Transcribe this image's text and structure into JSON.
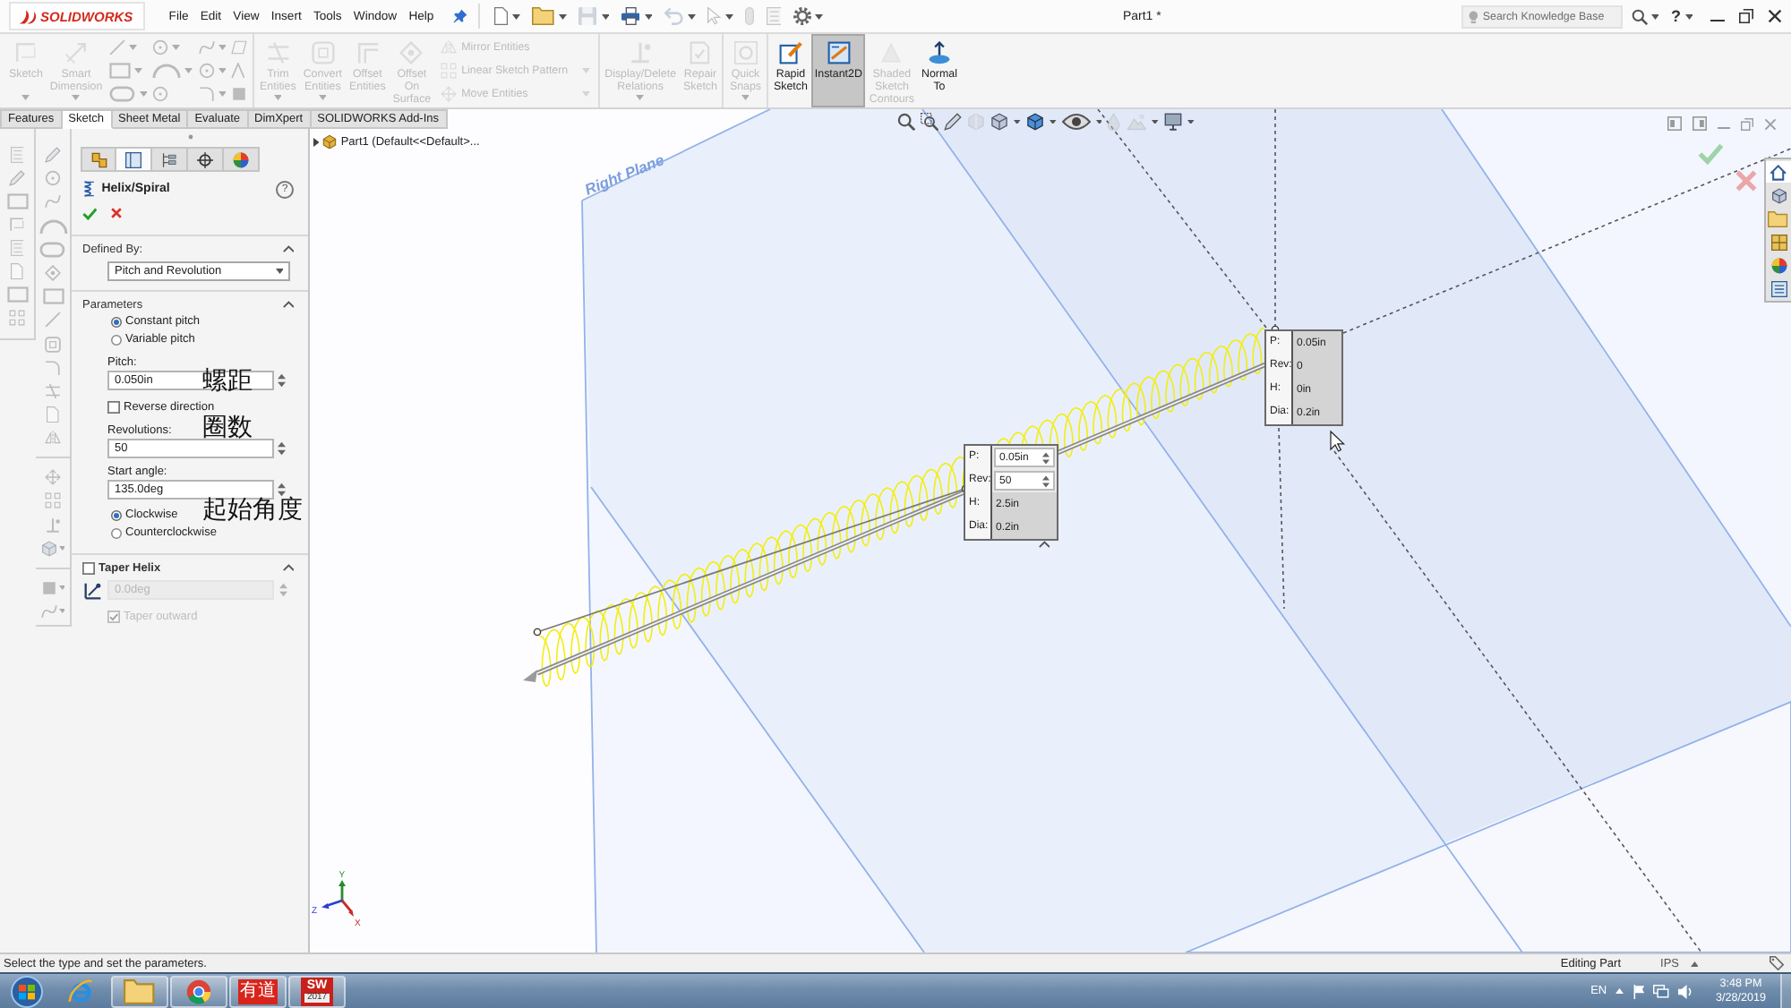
{
  "title_bar": {
    "logo": "SOLIDWORKS",
    "menu": [
      "File",
      "Edit",
      "View",
      "Insert",
      "Tools",
      "Window",
      "Help"
    ],
    "title": "Part1 *",
    "search": {
      "placeholder": "Search Knowledge Base"
    },
    "help": "?"
  },
  "quick_access": [
    {
      "disabled": false,
      "dropdown": true
    },
    {
      "disabled": false,
      "dropdown": true
    },
    {
      "disabled": true,
      "dropdown": true
    },
    {
      "disabled": false,
      "dropdown": true
    },
    {
      "disabled": true,
      "dropdown": true
    },
    {
      "disabled": true,
      "dropdown": true
    },
    {
      "disabled": true,
      "dropdown": false
    },
    {
      "disabled": true,
      "dropdown": false
    },
    {
      "disabled": false,
      "dropdown": true
    }
  ],
  "ribbon": {
    "groups": [
      [
        {
          "kind": "large",
          "label": "Sketch",
          "disabled": true,
          "on": false,
          "dropdown": true
        },
        {
          "kind": "large",
          "label": "Smart Dimension",
          "disabled": true,
          "on": false,
          "dropdown": true
        },
        {
          "kind": "entities",
          "disabled": true
        }
      ],
      [
        {
          "kind": "large",
          "label": "Trim Entities",
          "disabled": true,
          "on": false,
          "dropdown": true
        },
        {
          "kind": "large",
          "label": "Convert Entities",
          "disabled": true,
          "on": false,
          "dropdown": true
        },
        {
          "kind": "large",
          "label": "Offset Entities",
          "disabled": true,
          "on": false,
          "dropdown": false
        },
        {
          "kind": "large",
          "label": "Offset On Surface",
          "disabled": true,
          "on": false,
          "dropdown": false
        },
        {
          "kind": "stack",
          "disabled": true,
          "entries": [
            {
              "label": "Mirror Entities",
              "dropdown": false
            },
            {
              "label": "Linear Sketch Pattern",
              "dropdown": true
            },
            {
              "label": "Move Entities",
              "dropdown": true
            }
          ]
        }
      ],
      [
        {
          "kind": "large",
          "label": "Display/Delete Relations",
          "disabled": true,
          "on": false,
          "dropdown": true
        },
        {
          "kind": "large",
          "label": "Repair Sketch",
          "disabled": true,
          "on": false,
          "dropdown": false
        }
      ],
      [
        {
          "kind": "large",
          "label": "Quick Snaps",
          "disabled": true,
          "on": false,
          "dropdown": true
        }
      ],
      [
        {
          "kind": "large",
          "label": "Rapid Sketch",
          "disabled": false,
          "on": false,
          "dropdown": false
        },
        {
          "kind": "large",
          "label": "Instant2D",
          "disabled": false,
          "on": true,
          "dropdown": false
        },
        {
          "kind": "large",
          "label": "Shaded Sketch Contours",
          "disabled": true,
          "on": false,
          "dropdown": false
        },
        {
          "kind": "large",
          "label": "Normal To",
          "disabled": false,
          "on": false,
          "dropdown": false
        }
      ]
    ]
  },
  "command_tabs": [
    {
      "label": "Features",
      "selected": false
    },
    {
      "label": "Sketch",
      "selected": true
    },
    {
      "label": "Sheet Metal",
      "selected": false
    },
    {
      "label": "Evaluate",
      "selected": false
    },
    {
      "label": "DimXpert",
      "selected": false
    },
    {
      "label": "SOLIDWORKS Add-Ins",
      "selected": false
    }
  ],
  "side_toolbars": {
    "disabled": true
  },
  "property_manager": {
    "tabs": [
      {
        "selected": false
      },
      {
        "selected": true
      },
      {
        "selected": false
      },
      {
        "selected": false
      },
      {
        "selected": false
      }
    ],
    "title": "Helix/Spiral",
    "help": "?",
    "sections": [
      {
        "kind": "dropdown",
        "header": "Defined By:",
        "expanded": true,
        "value": "Pitch and Revolution"
      },
      {
        "kind": "group",
        "header": "Parameters",
        "expanded": true,
        "controls": [
          {
            "kind": "radio",
            "label": "Constant pitch",
            "selected": true,
            "disabled": false
          },
          {
            "kind": "radio",
            "label": "Variable pitch",
            "selected": false,
            "disabled": false
          },
          {
            "kind": "number",
            "label": "Pitch:",
            "value": "0.050in",
            "disabled": false
          },
          {
            "kind": "checkbox",
            "label": "Reverse direction",
            "checked": false,
            "disabled": false
          },
          {
            "kind": "number",
            "label": "Revolutions:",
            "value": "50",
            "disabled": false
          },
          {
            "kind": "number",
            "label": "Start angle:",
            "value": "135.0deg",
            "disabled": false
          },
          {
            "kind": "radio",
            "label": "Clockwise",
            "selected": true,
            "disabled": false
          },
          {
            "kind": "radio",
            "label": "Counterclockwise",
            "selected": false,
            "disabled": false
          }
        ]
      },
      {
        "kind": "checkbox_group",
        "header": "Taper Helix",
        "checked": false,
        "expanded": true,
        "controls": [
          {
            "kind": "number",
            "icon": true,
            "value": "0.0deg",
            "disabled": true
          },
          {
            "kind": "checkbox",
            "label": "Taper outward",
            "checked": true,
            "disabled": true
          }
        ]
      }
    ]
  },
  "annotations": [
    {
      "text": "螺距"
    },
    {
      "text": "圈数"
    },
    {
      "text": "起始角度"
    }
  ],
  "graphics": {
    "tree": {
      "expanded": false,
      "label": "Part1 (Default<<Default>..."
    },
    "view_toolbar": [
      {
        "disabled": false,
        "dropdown": false
      },
      {
        "disabled": false,
        "dropdown": false
      },
      {
        "disabled": false,
        "dropdown": false
      },
      {
        "disabled": true,
        "dropdown": false
      },
      {
        "disabled": false,
        "dropdown": true
      },
      {
        "disabled": false,
        "dropdown": true
      },
      {
        "disabled": false,
        "dropdown": true
      },
      {
        "disabled": true,
        "dropdown": false
      },
      {
        "disabled": true,
        "dropdown": true
      },
      {
        "disabled": false,
        "dropdown": true
      }
    ],
    "plane_label": "Right Plane",
    "popups": [
      {
        "collapse_handle": true,
        "rows": [
          {
            "label": "P:",
            "value": "0.05in",
            "editable": true
          },
          {
            "label": "Rev:",
            "value": "50",
            "editable": true
          },
          {
            "label": "H:",
            "value": "2.5in",
            "editable": false
          },
          {
            "label": "Dia:",
            "value": "0.2in",
            "editable": false
          }
        ]
      },
      {
        "collapse_handle": false,
        "rows": [
          {
            "label": "P:",
            "value": "0.05in",
            "editable": false
          },
          {
            "label": "Rev:",
            "value": "0",
            "editable": false
          },
          {
            "label": "H:",
            "value": "0in",
            "editable": false
          },
          {
            "label": "Dia:",
            "value": "0.2in",
            "editable": false
          }
        ]
      }
    ],
    "triad": [
      "Y",
      "X",
      "Z"
    ],
    "task_pane": [
      {
        "selected": true
      },
      {
        "selected": false
      },
      {
        "selected": false
      },
      {
        "selected": false
      },
      {
        "selected": false
      },
      {
        "selected": false
      }
    ]
  },
  "status_bar": {
    "message": "Select the type and set the parameters.",
    "mode": "Editing Part",
    "units": "IPS"
  },
  "taskbar": {
    "apps": [
      {
        "kind": "ie",
        "running": false
      },
      {
        "kind": "explorer",
        "running": true
      },
      {
        "kind": "chrome",
        "running": true
      },
      {
        "kind": "youdao",
        "running": true,
        "text": "有道"
      },
      {
        "kind": "solidworks",
        "running": true,
        "text": "SW",
        "sub": "2017"
      }
    ],
    "language": "EN",
    "time": "3:48 PM",
    "date": "3/28/2019"
  }
}
